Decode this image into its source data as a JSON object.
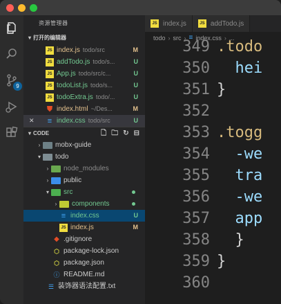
{
  "window": {
    "colors": {
      "close": "#ff5f57",
      "minimize": "#febc2e",
      "maximize": "#28c840",
      "accent": "#0e639c"
    }
  },
  "activity_bar": {
    "items": [
      "files-icon",
      "search-icon",
      "source-control-icon",
      "run-debug-icon",
      "extensions-icon"
    ],
    "scm_badge": "9"
  },
  "sidebar": {
    "title": "资源管理器",
    "open_editors": {
      "title": "打开的编辑器",
      "items": [
        {
          "name": "index.js",
          "path": "todo/src",
          "status": "M",
          "icon": "js-icon"
        },
        {
          "name": "addTodo.js",
          "path": "todo/s...",
          "status": "U",
          "icon": "js-icon"
        },
        {
          "name": "App.js",
          "path": "todo/src/c...",
          "status": "U",
          "icon": "js-icon"
        },
        {
          "name": "todoList.js",
          "path": "todo/s...",
          "status": "U",
          "icon": "js-icon"
        },
        {
          "name": "todoExtra.js",
          "path": "todo/...",
          "status": "U",
          "icon": "js-icon"
        },
        {
          "name": "index.html",
          "path": "~/Des...",
          "status": "M",
          "icon": "html-icon"
        },
        {
          "name": "index.css",
          "path": "todo/src",
          "status": "U",
          "icon": "css-icon",
          "close_glyph": "✕"
        }
      ]
    },
    "code_section": {
      "title": "CODE",
      "tools": [
        "new-file-icon",
        "new-folder-icon",
        "refresh-icon",
        "collapse-all-icon"
      ],
      "tree": [
        {
          "name": "mobx-guide",
          "kind": "folder",
          "expanded": false,
          "indent": 1
        },
        {
          "name": "todo",
          "kind": "folder",
          "expanded": true,
          "indent": 1
        },
        {
          "name": "node_modules",
          "kind": "folder",
          "expanded": false,
          "indent": 2,
          "status": "ignored"
        },
        {
          "name": "public",
          "kind": "folder",
          "expanded": false,
          "indent": 2
        },
        {
          "name": "src",
          "kind": "folder",
          "expanded": true,
          "indent": 2,
          "status": "dot"
        },
        {
          "name": "components",
          "kind": "folder",
          "expanded": false,
          "indent": 3,
          "status": "dot"
        },
        {
          "name": "index.css",
          "kind": "css",
          "indent": 3,
          "status": "U"
        },
        {
          "name": "index.js",
          "kind": "js",
          "indent": 3,
          "status": "M"
        },
        {
          "name": ".gitignore",
          "kind": "git",
          "indent": 2
        },
        {
          "name": "package-lock.json",
          "kind": "json",
          "indent": 2
        },
        {
          "name": "package.json",
          "kind": "json",
          "indent": 2
        },
        {
          "name": "README.md",
          "kind": "md",
          "indent": 2
        },
        {
          "name": "装饰器语法配置.txt",
          "kind": "txt",
          "indent": 1
        }
      ]
    }
  },
  "editor": {
    "tabs": [
      {
        "name": "index.js",
        "icon": "js-icon"
      },
      {
        "name": "addTodo.js",
        "icon": "js-icon"
      }
    ],
    "breadcrumb": [
      "todo",
      "src",
      "index.css",
      "..."
    ],
    "lines": [
      {
        "n": "349",
        "text": ".todo"
      },
      {
        "n": "350",
        "text": "  hei"
      },
      {
        "n": "351",
        "text": "}"
      },
      {
        "n": "352",
        "text": ""
      },
      {
        "n": "353",
        "text": ".togg"
      },
      {
        "n": "354",
        "text": "  -we"
      },
      {
        "n": "355",
        "text": "  tra"
      },
      {
        "n": "356",
        "text": "  -we"
      },
      {
        "n": "357",
        "text": "  app"
      },
      {
        "n": "358",
        "text": "  }"
      },
      {
        "n": "359",
        "text": "}"
      },
      {
        "n": "360",
        "text": ""
      }
    ]
  }
}
